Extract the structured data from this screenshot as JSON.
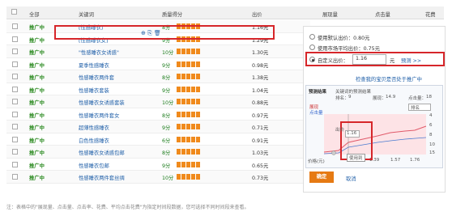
{
  "header": {
    "all": "全部",
    "keyword": "关键词",
    "quality": "质量得分",
    "bid": "出价",
    "impressions": "展现量",
    "clicks": "点击量",
    "cost": "花费"
  },
  "rows": [
    {
      "status": "推广中",
      "keyword": "[性感睡衣]",
      "quality": "8分",
      "bid": "1.16元"
    },
    {
      "status": "推广中",
      "keyword": "[性感睡衣女]",
      "quality": "9分",
      "bid": "1.29元"
    },
    {
      "status": "推广中",
      "keyword": "\"性感睡衣女诱惑\"",
      "quality": "10分",
      "bid": "1.30元"
    },
    {
      "status": "推广中",
      "keyword": "夏季性感睡衣",
      "quality": "9分",
      "bid": "0.98元"
    },
    {
      "status": "推广中",
      "keyword": "性感睡衣两件套",
      "quality": "8分",
      "bid": "1.38元"
    },
    {
      "status": "推广中",
      "keyword": "性感睡衣套装",
      "quality": "9分",
      "bid": "1.04元"
    },
    {
      "status": "推广中",
      "keyword": "性感睡衣女诱惑套装",
      "quality": "10分",
      "bid": "0.88元"
    },
    {
      "status": "推广中",
      "keyword": "性感睡衣两件套女",
      "quality": "8分",
      "bid": "0.97元"
    },
    {
      "status": "推广中",
      "keyword": "超薄性感睡衣",
      "quality": "9分",
      "bid": "0.71元"
    },
    {
      "status": "推广中",
      "keyword": "白色性感睡衣",
      "quality": "6分",
      "bid": "0.91元"
    },
    {
      "status": "推广中",
      "keyword": "性感睡衣女诱惑包邮",
      "quality": "8分",
      "bid": "1.03元"
    },
    {
      "status": "推广中",
      "keyword": "性感睡衣包邮",
      "quality": "9分",
      "bid": "0.65元"
    },
    {
      "status": "推广中",
      "keyword": "性感睡衣两件套丝绸",
      "quality": "10分",
      "bid": "0.73元"
    }
  ],
  "panel": {
    "opt1": "使用默认出价：0.80元",
    "opt2": "使用市场平均出价：0.75元",
    "opt3": "自定义出价：",
    "custom_value": "1.16",
    "unit": "元",
    "predict": "预测 >>",
    "check_link": "检查我的宝贝是否处于推广中",
    "tab": "预测结果",
    "summary": "关键词的预测结果",
    "rank_label": "排名：",
    "rank": "9",
    "show_label": "展现：",
    "show_val": "14.9",
    "click_label": "点击量：",
    "click_val": "18",
    "legend1": "展现",
    "legend2": "点击量",
    "dropdown": "排名",
    "price_axis": "价格(元)",
    "x_ticks": [
      "1.39",
      "1.57",
      "1.76"
    ],
    "y_ticks": [
      "4",
      "6",
      "8",
      "10",
      "15"
    ],
    "bid_label": "出价",
    "bid_box": "1.16",
    "tooltip": "使用到",
    "confirm": "确定",
    "cancel": "取消"
  },
  "footer": "注：表格中的\"展现量、点击量、点击率、花费、平均点击花费\"为指定时间段数据，您可选择不同时间段来查看。",
  "colors": {
    "accent": "#e67a13",
    "status": "#2b8a20",
    "link": "#1f5fa8",
    "highlight": "#d6262a"
  }
}
